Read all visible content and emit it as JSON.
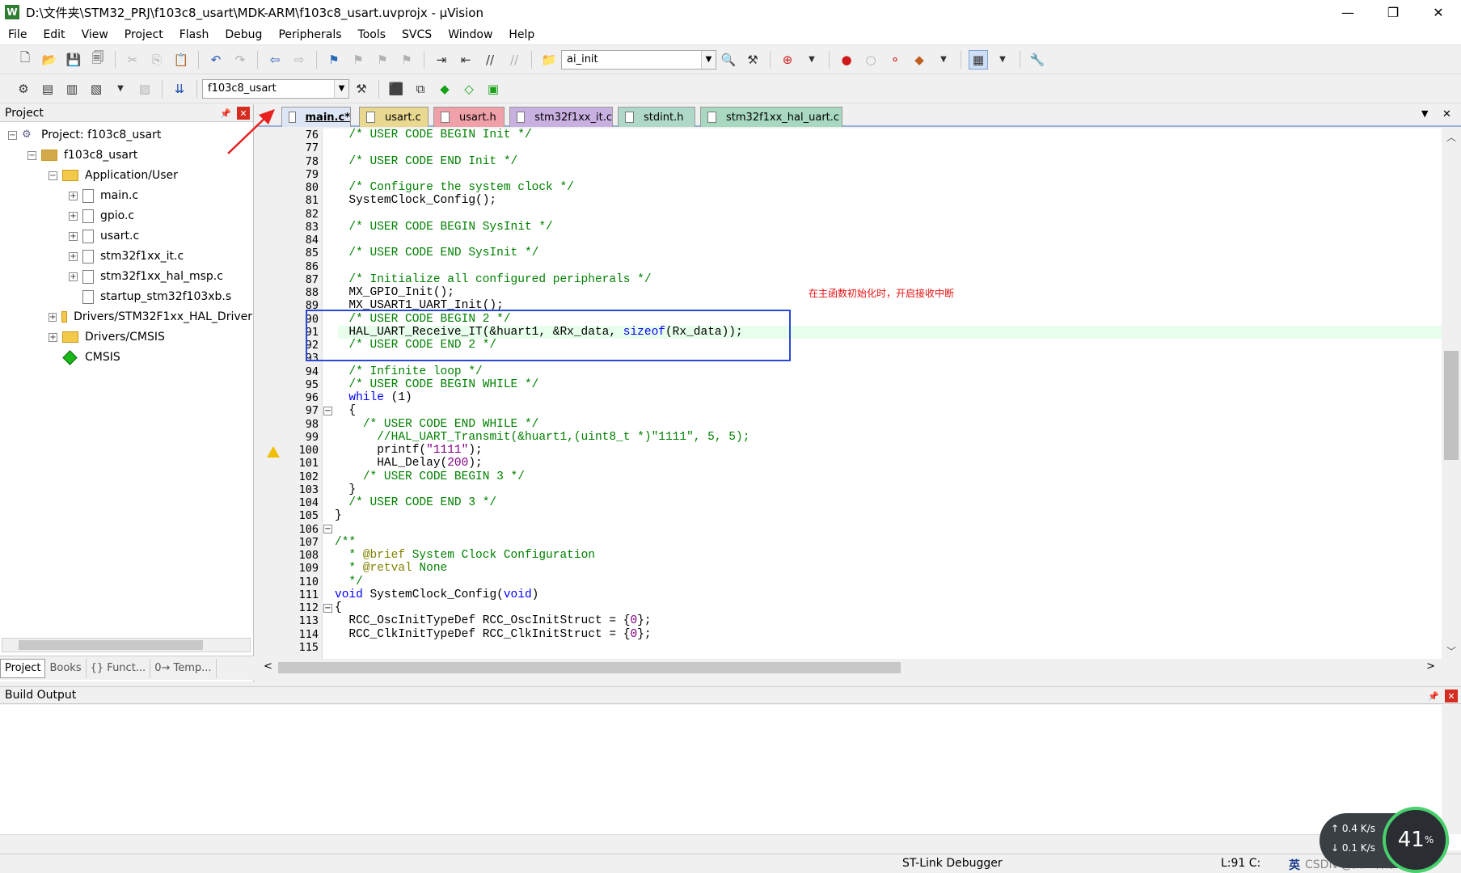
{
  "window": {
    "title": "D:\\文件夹\\STM32_PRJ\\f103c8_usart\\MDK-ARM\\f103c8_usart.uvprojx - µVision",
    "app_icon": "W",
    "minimize": "—",
    "restore": "❐",
    "close": "✕"
  },
  "menu": [
    "File",
    "Edit",
    "View",
    "Project",
    "Flash",
    "Debug",
    "Peripherals",
    "Tools",
    "SVCS",
    "Window",
    "Help"
  ],
  "toolbar": {
    "find_combo_value": "ai_init",
    "target_combo_value": "f103c8_usart"
  },
  "project_panel": {
    "title": "Project",
    "tree": {
      "root": "Project: f103c8_usart",
      "target": "f103c8_usart",
      "group_app": "Application/User",
      "files": [
        "main.c",
        "gpio.c",
        "usart.c",
        "stm32f1xx_it.c",
        "stm32f1xx_hal_msp.c",
        "startup_stm32f103xb.s"
      ],
      "group_drivers": "Drivers/STM32F1xx_HAL_Driver",
      "group_cmsis_drivers": "Drivers/CMSIS",
      "cmsis": "CMSIS"
    },
    "bottom_tabs": [
      "Project",
      "Books",
      "{} Funct...",
      "0→ Temp..."
    ]
  },
  "editor": {
    "tabs": [
      "main.c*",
      "usart.c",
      "usart.h",
      "stm32f1xx_it.c",
      "stdint.h",
      "stm32f1xx_hal_uart.c"
    ],
    "tab_colors": [
      "#dde6f4",
      "#e8d890",
      "#f0a0a8",
      "#c8b0e0",
      "#b0d8c8",
      "#a8d8c0"
    ],
    "line_numbers": [
      "76",
      "77",
      "78",
      "79",
      "80",
      "81",
      "82",
      "83",
      "84",
      "85",
      "86",
      "87",
      "88",
      "89",
      "90",
      "91",
      "92",
      "93",
      "94",
      "95",
      "96",
      "97",
      "98",
      "99",
      "100",
      "101",
      "102",
      "103",
      "104",
      "105",
      "106",
      "107",
      "108",
      "109",
      "110",
      "111",
      "112",
      "113",
      "114",
      "115"
    ],
    "annotation_text": "在主函数初始化时，开启接收中断"
  },
  "build_output": {
    "title": "Build Output"
  },
  "status": {
    "debugger": "ST-Link Debugger",
    "position": "L:91 C:",
    "ime": "英"
  },
  "net_widget": {
    "up": "0.4",
    "up_unit": "K/s",
    "down": "0.1",
    "down_unit": "K/s",
    "percent": "41",
    "watermark": "CSDN @西红柿炒鸡蛋"
  }
}
